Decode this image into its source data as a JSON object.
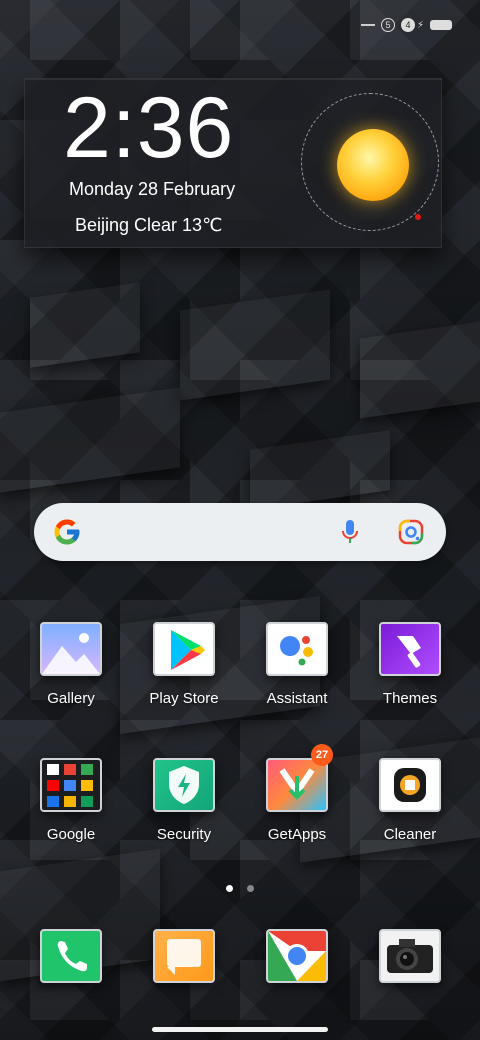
{
  "status_bar": {
    "sim1": "5",
    "sim2": "4"
  },
  "widget": {
    "time": "2:36",
    "date": "Monday 28 February",
    "weather": "Beijing  Clear  13℃"
  },
  "search": {
    "logo_icon": "google-g-icon",
    "mic_icon": "mic-icon",
    "lens_icon": "lens-icon"
  },
  "apps_row1": [
    {
      "label": "Gallery",
      "icon": "gallery-icon"
    },
    {
      "label": "Play Store",
      "icon": "play-store-icon"
    },
    {
      "label": "Assistant",
      "icon": "assistant-icon"
    },
    {
      "label": "Themes",
      "icon": "themes-icon"
    }
  ],
  "apps_row2": [
    {
      "label": "Google",
      "icon": "google-folder-icon"
    },
    {
      "label": "Security",
      "icon": "security-icon"
    },
    {
      "label": "GetApps",
      "icon": "getapps-icon",
      "badge": "27"
    },
    {
      "label": "Cleaner",
      "icon": "cleaner-icon"
    }
  ],
  "dock": [
    {
      "icon": "phone-icon"
    },
    {
      "icon": "messages-icon"
    },
    {
      "icon": "chrome-icon"
    },
    {
      "icon": "camera-icon"
    }
  ],
  "pages": {
    "count": 2,
    "active": 0
  }
}
